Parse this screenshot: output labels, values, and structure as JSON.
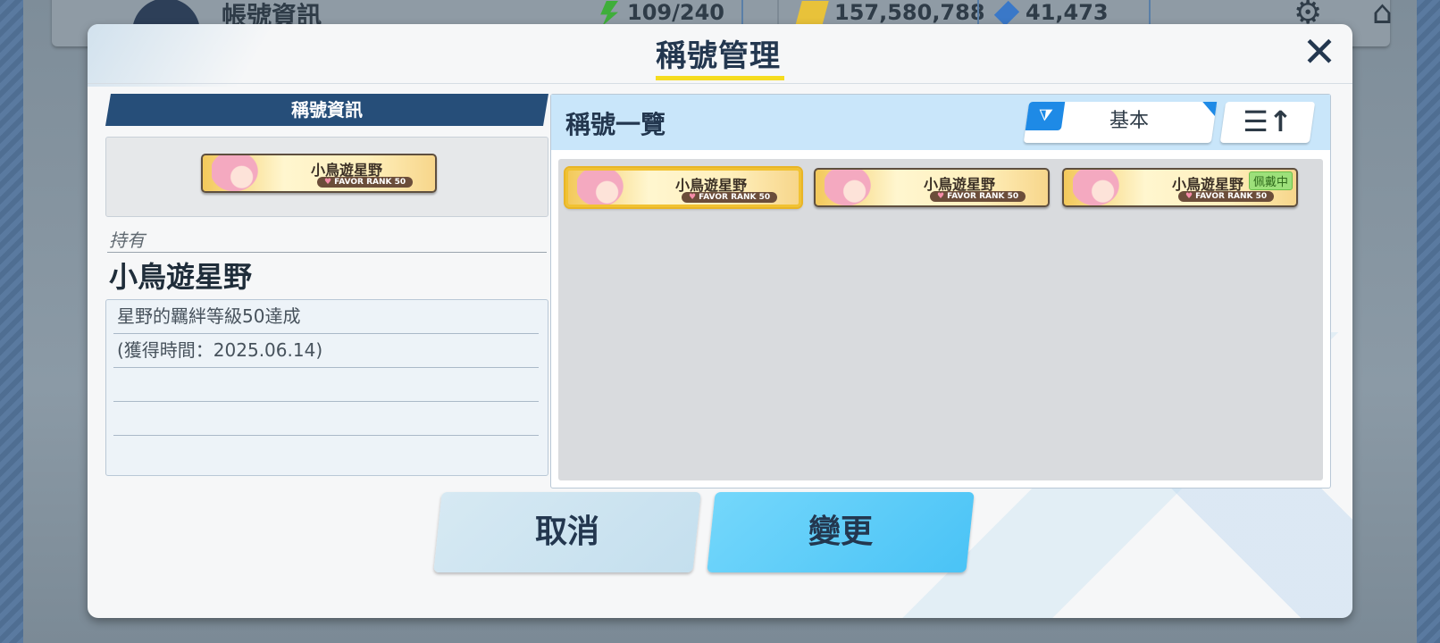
{
  "background": {
    "screen_title": "帳號資訊",
    "resources": [
      {
        "icon": "ap-icon",
        "value": "109/240"
      },
      {
        "icon": "credit-icon",
        "value": "157,580,788"
      },
      {
        "icon": "pyroxene-icon",
        "value": "41,473"
      }
    ]
  },
  "dialog": {
    "title": "稱號管理",
    "close_label": "✕"
  },
  "info": {
    "header": "稱號資訊",
    "preview_card": {
      "name": "小鳥遊星野",
      "rank": "FAVOR RANK 50"
    },
    "owned_label": "持有",
    "owned_name": "小鳥遊星野",
    "description_lines": [
      "星野的羈絆等級50達成",
      "(獲得時間：2025.06.14)",
      "",
      "",
      ""
    ]
  },
  "list": {
    "title": "稱號一覽",
    "filter_label": "基本",
    "sort_icon": "☰↑",
    "cards": [
      {
        "name": "小鳥遊星野",
        "rank": "FAVOR RANK 50",
        "selected": true,
        "tag": ""
      },
      {
        "name": "小鳥遊星野",
        "rank": "FAVOR RANK 50",
        "selected": false,
        "tag": ""
      },
      {
        "name": "小鳥遊星野",
        "rank": "FAVOR RANK 50",
        "selected": false,
        "tag": "佩戴中"
      }
    ]
  },
  "buttons": {
    "cancel": "取消",
    "confirm": "變更"
  },
  "colors": {
    "accent_yellow": "#f5dc1f",
    "header_navy": "#264e79",
    "confirm_blue": "#4ac3f6"
  }
}
